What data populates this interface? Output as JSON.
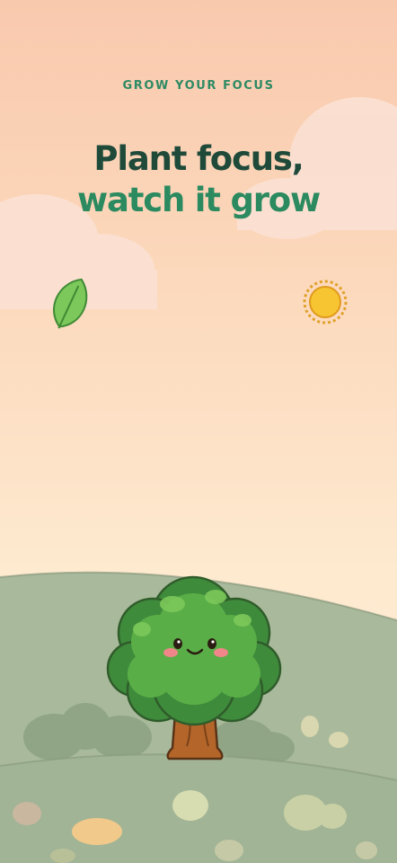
{
  "onboarding": {
    "eyebrow": "GROW YOUR FOCUS",
    "headline_line1": "Plant focus,",
    "headline_line2": "watch it grow"
  },
  "colors": {
    "eyebrow": "#2e8a64",
    "headline_dark": "#1f4a3a",
    "headline_green": "#2b8a5f",
    "sky_top": "#f9c9ae",
    "sky_bottom": "#fdebd2",
    "hill_back": "#a8b89a",
    "hill_front": "#9fb294",
    "tree_leaves": "#4fa34a",
    "tree_trunk": "#b4662a",
    "sun": "#f7c531",
    "leaf": "#7cc85a"
  },
  "icons": {
    "leaf": "leaf-icon",
    "sun": "sun-icon",
    "tree": "tree-mascot"
  }
}
